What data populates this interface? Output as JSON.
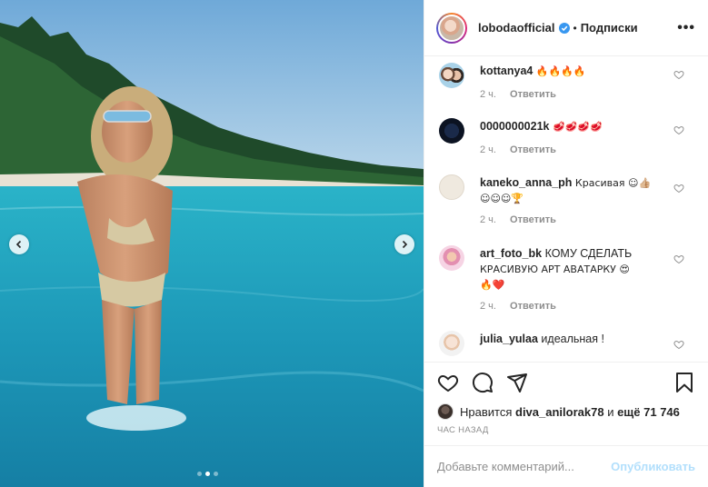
{
  "header": {
    "username": "lobodaofficial",
    "separator": "•",
    "follow_label": "Подписки",
    "more_label": "•••"
  },
  "comments": [
    {
      "user": "kottanya4",
      "text": "🔥🔥🔥🔥",
      "time": "2 ч.",
      "reply": "Ответить"
    },
    {
      "user": "0000000021k",
      "text": "🥩🥩🥩🥩",
      "time": "2 ч.",
      "reply": "Ответить"
    },
    {
      "user": "kaneko_anna_ph",
      "text": "Красивая ☺👍🏼",
      "text2": "☺☺☺🏆",
      "time": "2 ч.",
      "reply": "Ответить"
    },
    {
      "user": "art_foto_bk",
      "text": "КОМУ СДЕЛАТЬ",
      "text2": "КРАСИВУЮ АРТ АВАТАРКУ 😍",
      "text3": "🔥❤️",
      "time": "2 ч.",
      "reply": "Ответить"
    },
    {
      "user": "julia_yulaa",
      "text": "идеальная !"
    }
  ],
  "likes": {
    "prefix": "Нравится",
    "user": "diva_anilorak78",
    "middle": "и",
    "rest": "ещё 71 746"
  },
  "time_ago": "ЧАС НАЗАД",
  "add_comment": {
    "placeholder": "Добавьте комментарий...",
    "publish_label": "Опубликовать"
  },
  "carousel": {
    "slides": 3,
    "active_index": 1
  },
  "colors": {
    "accent": "#0095f6",
    "publish_disabled": "#b2dffc",
    "secondary_text": "#8e8e8e",
    "verified": "#3897f0"
  }
}
